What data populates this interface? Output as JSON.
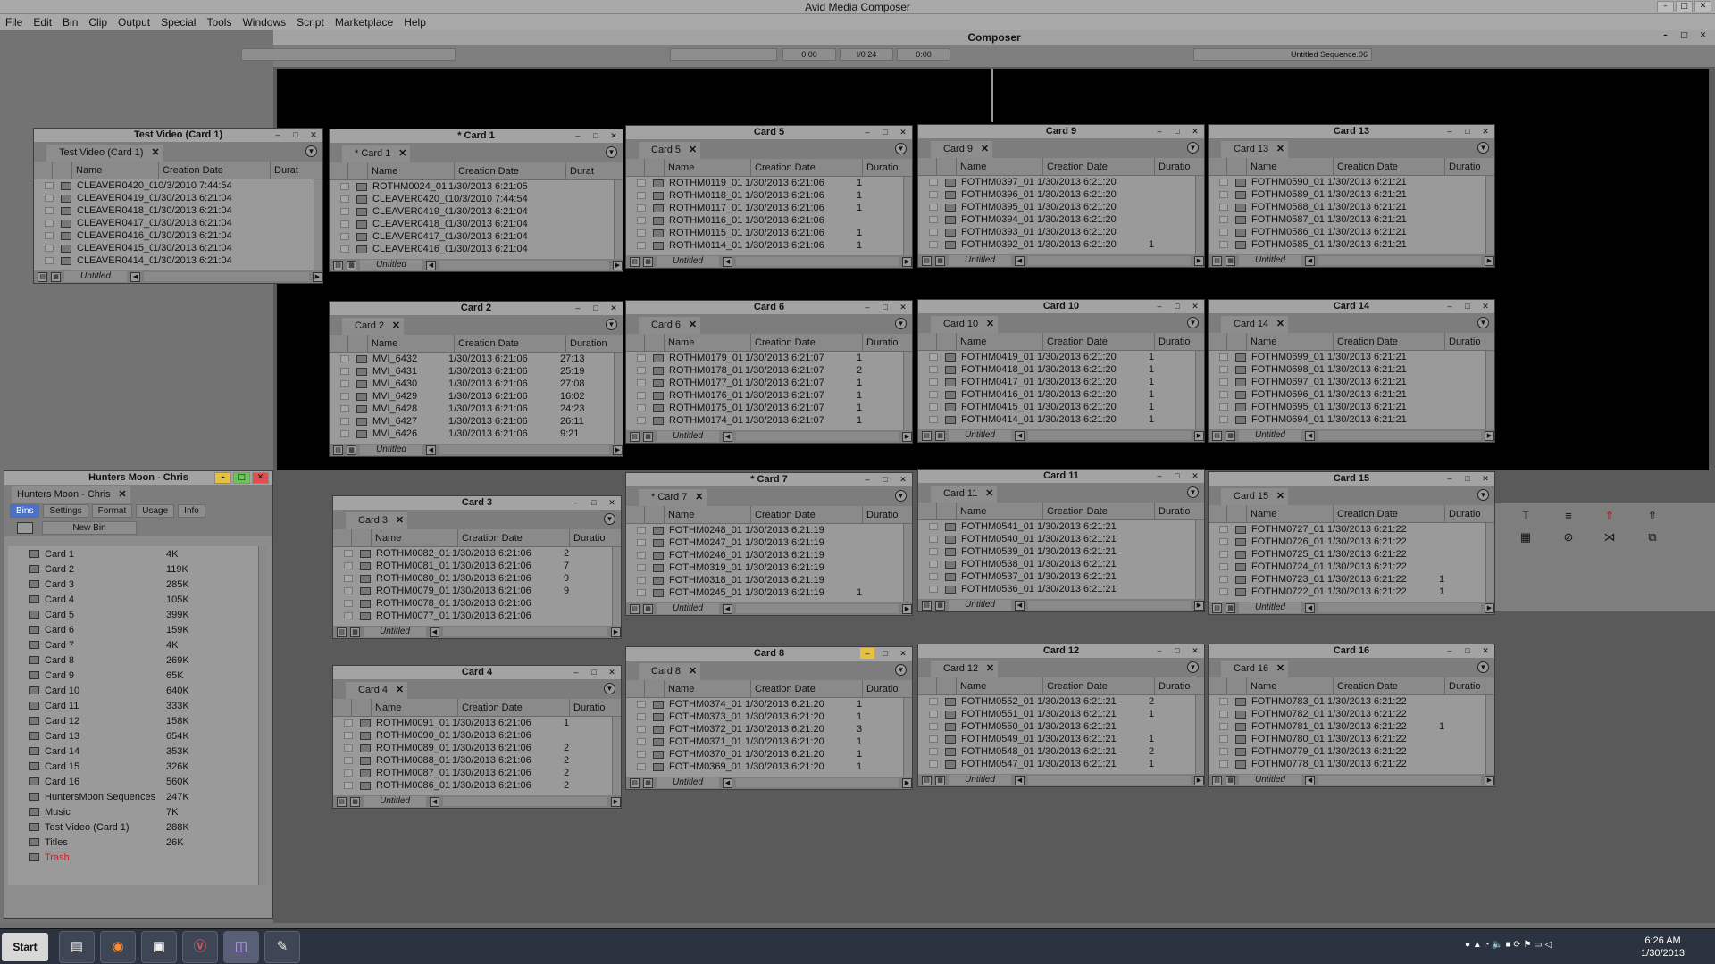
{
  "app_title": "Avid Media Composer",
  "menu": [
    "File",
    "Edit",
    "Bin",
    "Clip",
    "Output",
    "Special",
    "Tools",
    "Windows",
    "Script",
    "Marketplace",
    "Help"
  ],
  "composer": {
    "title": "Composer",
    "timecode_left": "0:00",
    "timecode_mid": "I/0 24",
    "timecode_right": "0:00",
    "sequence": "Untitled Sequence.06"
  },
  "bin_headers": {
    "name": "Name",
    "date": "Creation Date",
    "duration": "Duration"
  },
  "untitled": "Untitled",
  "bins": [
    {
      "title": "Test Video (Card 1)",
      "tab": "Test Video (Card 1)",
      "dur_header": "Durat",
      "rows": [
        [
          "CLEAVER0420_01",
          "10/3/2010 7:44:54",
          ""
        ],
        [
          "CLEAVER0419_01",
          "1/30/2013 6:21:04",
          ""
        ],
        [
          "CLEAVER0418_01",
          "1/30/2013 6:21:04",
          ""
        ],
        [
          "CLEAVER0417_01",
          "1/30/2013 6:21:04",
          ""
        ],
        [
          "CLEAVER0416_01",
          "1/30/2013 6:21:04",
          ""
        ],
        [
          "CLEAVER0415_01",
          "1/30/2013 6:21:04",
          ""
        ],
        [
          "CLEAVER0414_01",
          "1/30/2013 6:21:04",
          ""
        ]
      ]
    },
    {
      "title": "* Card 1",
      "tab": "* Card 1",
      "dur_header": "Durat",
      "rows": [
        [
          "ROTHM0024_01",
          "1/30/2013 6:21:05",
          ""
        ],
        [
          "CLEAVER0420_01",
          "10/3/2010 7:44:54",
          ""
        ],
        [
          "CLEAVER0419_01",
          "1/30/2013 6:21:04",
          ""
        ],
        [
          "CLEAVER0418_01",
          "1/30/2013 6:21:04",
          ""
        ],
        [
          "CLEAVER0417_01",
          "1/30/2013 6:21:04",
          ""
        ],
        [
          "CLEAVER0416_01",
          "1/30/2013 6:21:04",
          ""
        ]
      ]
    },
    {
      "title": "Card 2",
      "tab": "Card 2",
      "dur_header": "Duration",
      "rows": [
        [
          "MVI_6432",
          "1/30/2013 6:21:06",
          "27:13"
        ],
        [
          "MVI_6431",
          "1/30/2013 6:21:06",
          "25:19"
        ],
        [
          "MVI_6430",
          "1/30/2013 6:21:06",
          "27:08"
        ],
        [
          "MVI_6429",
          "1/30/2013 6:21:06",
          "16:02"
        ],
        [
          "MVI_6428",
          "1/30/2013 6:21:06",
          "24:23"
        ],
        [
          "MVI_6427",
          "1/30/2013 6:21:06",
          "26:11"
        ],
        [
          "MVI_6426",
          "1/30/2013 6:21:06",
          "9:21"
        ]
      ]
    },
    {
      "title": "Card 3",
      "tab": "Card 3",
      "dur_header": "Duratio",
      "rows": [
        [
          "ROTHM0082_01",
          "1/30/2013 6:21:06",
          "2"
        ],
        [
          "ROTHM0081_01",
          "1/30/2013 6:21:06",
          "7"
        ],
        [
          "ROTHM0080_01",
          "1/30/2013 6:21:06",
          "9"
        ],
        [
          "ROTHM0079_01",
          "1/30/2013 6:21:06",
          "9"
        ],
        [
          "ROTHM0078_01",
          "1/30/2013 6:21:06",
          ""
        ],
        [
          "ROTHM0077_01",
          "1/30/2013 6:21:06",
          ""
        ]
      ]
    },
    {
      "title": "Card 4",
      "tab": "Card 4",
      "dur_header": "Duratio",
      "rows": [
        [
          "ROTHM0091_01",
          "1/30/2013 6:21:06",
          "1"
        ],
        [
          "ROTHM0090_01",
          "1/30/2013 6:21:06",
          ""
        ],
        [
          "ROTHM0089_01",
          "1/30/2013 6:21:06",
          "2"
        ],
        [
          "ROTHM0088_01",
          "1/30/2013 6:21:06",
          "2"
        ],
        [
          "ROTHM0087_01",
          "1/30/2013 6:21:06",
          "2"
        ],
        [
          "ROTHM0086_01",
          "1/30/2013 6:21:06",
          "2"
        ]
      ]
    },
    {
      "title": "Card 5",
      "tab": "Card 5",
      "dur_header": "Duratio",
      "rows": [
        [
          "ROTHM0119_01",
          "1/30/2013 6:21:06",
          "1"
        ],
        [
          "ROTHM0118_01",
          "1/30/2013 6:21:06",
          "1"
        ],
        [
          "ROTHM0117_01",
          "1/30/2013 6:21:06",
          "1"
        ],
        [
          "ROTHM0116_01",
          "1/30/2013 6:21:06",
          ""
        ],
        [
          "ROTHM0115_01",
          "1/30/2013 6:21:06",
          "1"
        ],
        [
          "ROTHM0114_01",
          "1/30/2013 6:21:06",
          "1"
        ]
      ]
    },
    {
      "title": "Card 6",
      "tab": "Card 6",
      "dur_header": "Duratio",
      "rows": [
        [
          "ROTHM0179_01",
          "1/30/2013 6:21:07",
          "1"
        ],
        [
          "ROTHM0178_01",
          "1/30/2013 6:21:07",
          "2"
        ],
        [
          "ROTHM0177_01",
          "1/30/2013 6:21:07",
          "1"
        ],
        [
          "ROTHM0176_01",
          "1/30/2013 6:21:07",
          "1"
        ],
        [
          "ROTHM0175_01",
          "1/30/2013 6:21:07",
          "1"
        ],
        [
          "ROTHM0174_01",
          "1/30/2013 6:21:07",
          "1"
        ]
      ]
    },
    {
      "title": "* Card 7",
      "tab": "* Card 7",
      "dur_header": "Duratio",
      "rows": [
        [
          "FOTHM0248_01",
          "1/30/2013 6:21:19",
          ""
        ],
        [
          "FOTHM0247_01",
          "1/30/2013 6:21:19",
          ""
        ],
        [
          "FOTHM0246_01",
          "1/30/2013 6:21:19",
          ""
        ],
        [
          "FOTHM0319_01",
          "1/30/2013 6:21:19",
          ""
        ],
        [
          "FOTHM0318_01",
          "1/30/2013 6:21:19",
          ""
        ],
        [
          "FOTHM0245_01",
          "1/30/2013 6:21:19",
          "1"
        ]
      ]
    },
    {
      "title": "Card 8",
      "tab": "Card 8",
      "dur_header": "Duratio",
      "rows": [
        [
          "FOTHM0374_01",
          "1/30/2013 6:21:20",
          "1"
        ],
        [
          "FOTHM0373_01",
          "1/30/2013 6:21:20",
          "1"
        ],
        [
          "FOTHM0372_01",
          "1/30/2013 6:21:20",
          "3"
        ],
        [
          "FOTHM0371_01",
          "1/30/2013 6:21:20",
          "1"
        ],
        [
          "FOTHM0370_01",
          "1/30/2013 6:21:20",
          "1"
        ],
        [
          "FOTHM0369_01",
          "1/30/2013 6:21:20",
          "1"
        ]
      ]
    },
    {
      "title": "Card 9",
      "tab": "Card 9",
      "dur_header": "Duratio",
      "rows": [
        [
          "FOTHM0397_01",
          "1/30/2013 6:21:20",
          ""
        ],
        [
          "FOTHM0396_01",
          "1/30/2013 6:21:20",
          ""
        ],
        [
          "FOTHM0395_01",
          "1/30/2013 6:21:20",
          ""
        ],
        [
          "FOTHM0394_01",
          "1/30/2013 6:21:20",
          ""
        ],
        [
          "FOTHM0393_01",
          "1/30/2013 6:21:20",
          ""
        ],
        [
          "FOTHM0392_01",
          "1/30/2013 6:21:20",
          "1"
        ]
      ]
    },
    {
      "title": "Card 10",
      "tab": "Card 10",
      "dur_header": "Duratio",
      "rows": [
        [
          "FOTHM0419_01",
          "1/30/2013 6:21:20",
          "1"
        ],
        [
          "FOTHM0418_01",
          "1/30/2013 6:21:20",
          "1"
        ],
        [
          "FOTHM0417_01",
          "1/30/2013 6:21:20",
          "1"
        ],
        [
          "FOTHM0416_01",
          "1/30/2013 6:21:20",
          "1"
        ],
        [
          "FOTHM0415_01",
          "1/30/2013 6:21:20",
          "1"
        ],
        [
          "FOTHM0414_01",
          "1/30/2013 6:21:20",
          "1"
        ]
      ]
    },
    {
      "title": "Card 11",
      "tab": "Card 11",
      "dur_header": "Duratio",
      "rows": [
        [
          "FOTHM0541_01",
          "1/30/2013 6:21:21",
          ""
        ],
        [
          "FOTHM0540_01",
          "1/30/2013 6:21:21",
          ""
        ],
        [
          "FOTHM0539_01",
          "1/30/2013 6:21:21",
          ""
        ],
        [
          "FOTHM0538_01",
          "1/30/2013 6:21:21",
          ""
        ],
        [
          "FOTHM0537_01",
          "1/30/2013 6:21:21",
          ""
        ],
        [
          "FOTHM0536_01",
          "1/30/2013 6:21:21",
          ""
        ]
      ]
    },
    {
      "title": "Card 12",
      "tab": "Card 12",
      "dur_header": "Duratio",
      "rows": [
        [
          "FOTHM0552_01",
          "1/30/2013 6:21:21",
          "2"
        ],
        [
          "FOTHM0551_01",
          "1/30/2013 6:21:21",
          "1"
        ],
        [
          "FOTHM0550_01",
          "1/30/2013 6:21:21",
          ""
        ],
        [
          "FOTHM0549_01",
          "1/30/2013 6:21:21",
          "1"
        ],
        [
          "FOTHM0548_01",
          "1/30/2013 6:21:21",
          "2"
        ],
        [
          "FOTHM0547_01",
          "1/30/2013 6:21:21",
          "1"
        ]
      ]
    },
    {
      "title": "Card 13",
      "tab": "Card 13",
      "dur_header": "Duratio",
      "rows": [
        [
          "FOTHM0590_01",
          "1/30/2013 6:21:21",
          ""
        ],
        [
          "FOTHM0589_01",
          "1/30/2013 6:21:21",
          ""
        ],
        [
          "FOTHM0588_01",
          "1/30/2013 6:21:21",
          ""
        ],
        [
          "FOTHM0587_01",
          "1/30/2013 6:21:21",
          ""
        ],
        [
          "FOTHM0586_01",
          "1/30/2013 6:21:21",
          ""
        ],
        [
          "FOTHM0585_01",
          "1/30/2013 6:21:21",
          ""
        ]
      ]
    },
    {
      "title": "Card 14",
      "tab": "Card 14",
      "dur_header": "Duratio",
      "rows": [
        [
          "FOTHM0699_01",
          "1/30/2013 6:21:21",
          ""
        ],
        [
          "FOTHM0698_01",
          "1/30/2013 6:21:21",
          ""
        ],
        [
          "FOTHM0697_01",
          "1/30/2013 6:21:21",
          ""
        ],
        [
          "FOTHM0696_01",
          "1/30/2013 6:21:21",
          ""
        ],
        [
          "FOTHM0695_01",
          "1/30/2013 6:21:21",
          ""
        ],
        [
          "FOTHM0694_01",
          "1/30/2013 6:21:21",
          ""
        ]
      ]
    },
    {
      "title": "Card 15",
      "tab": "Card 15",
      "dur_header": "Duratio",
      "rows": [
        [
          "FOTHM0727_01",
          "1/30/2013 6:21:22",
          ""
        ],
        [
          "FOTHM0726_01",
          "1/30/2013 6:21:22",
          ""
        ],
        [
          "FOTHM0725_01",
          "1/30/2013 6:21:22",
          ""
        ],
        [
          "FOTHM0724_01",
          "1/30/2013 6:21:22",
          ""
        ],
        [
          "FOTHM0723_01",
          "1/30/2013 6:21:22",
          "1"
        ],
        [
          "FOTHM0722_01",
          "1/30/2013 6:21:22",
          "1"
        ]
      ]
    },
    {
      "title": "Card 16",
      "tab": "Card 16",
      "dur_header": "Duratio",
      "rows": [
        [
          "FOTHM0783_01",
          "1/30/2013 6:21:22",
          ""
        ],
        [
          "FOTHM0782_01",
          "1/30/2013 6:21:22",
          ""
        ],
        [
          "FOTHM0781_01",
          "1/30/2013 6:21:22",
          "1"
        ],
        [
          "FOTHM0780_01",
          "1/30/2013 6:21:22",
          ""
        ],
        [
          "FOTHM0779_01",
          "1/30/2013 6:21:22",
          ""
        ],
        [
          "FOTHM0778_01",
          "1/30/2013 6:21:22",
          ""
        ]
      ]
    }
  ],
  "project": {
    "title": "Hunters Moon - Chris",
    "tab": "Hunters Moon - Chris",
    "tabs": [
      "Bins",
      "Settings",
      "Format",
      "Usage",
      "Info"
    ],
    "new_bin": "New Bin",
    "items": [
      [
        "Card 1",
        "4K"
      ],
      [
        "Card 2",
        "119K"
      ],
      [
        "Card 3",
        "285K"
      ],
      [
        "Card 4",
        "105K"
      ],
      [
        "Card 5",
        "399K"
      ],
      [
        "Card 6",
        "159K"
      ],
      [
        "Card 7",
        "4K"
      ],
      [
        "Card 8",
        "269K"
      ],
      [
        "Card 9",
        "65K"
      ],
      [
        "Card 10",
        "640K"
      ],
      [
        "Card 11",
        "333K"
      ],
      [
        "Card 12",
        "158K"
      ],
      [
        "Card 13",
        "654K"
      ],
      [
        "Card 14",
        "353K"
      ],
      [
        "Card 15",
        "326K"
      ],
      [
        "Card 16",
        "560K"
      ],
      [
        "HuntersMoon Sequences",
        "247K"
      ],
      [
        "Music",
        "7K"
      ],
      [
        "Test Video (Card 1)",
        "288K"
      ],
      [
        "Titles",
        "26K"
      ],
      [
        "Trash",
        ""
      ]
    ]
  },
  "taskbar": {
    "start": "Start",
    "time": "6:26 AM",
    "date": "1/30/2013"
  },
  "colors": {
    "trash": "#d02020",
    "active_title": "#ffd24a",
    "close_red": "#e05050"
  }
}
